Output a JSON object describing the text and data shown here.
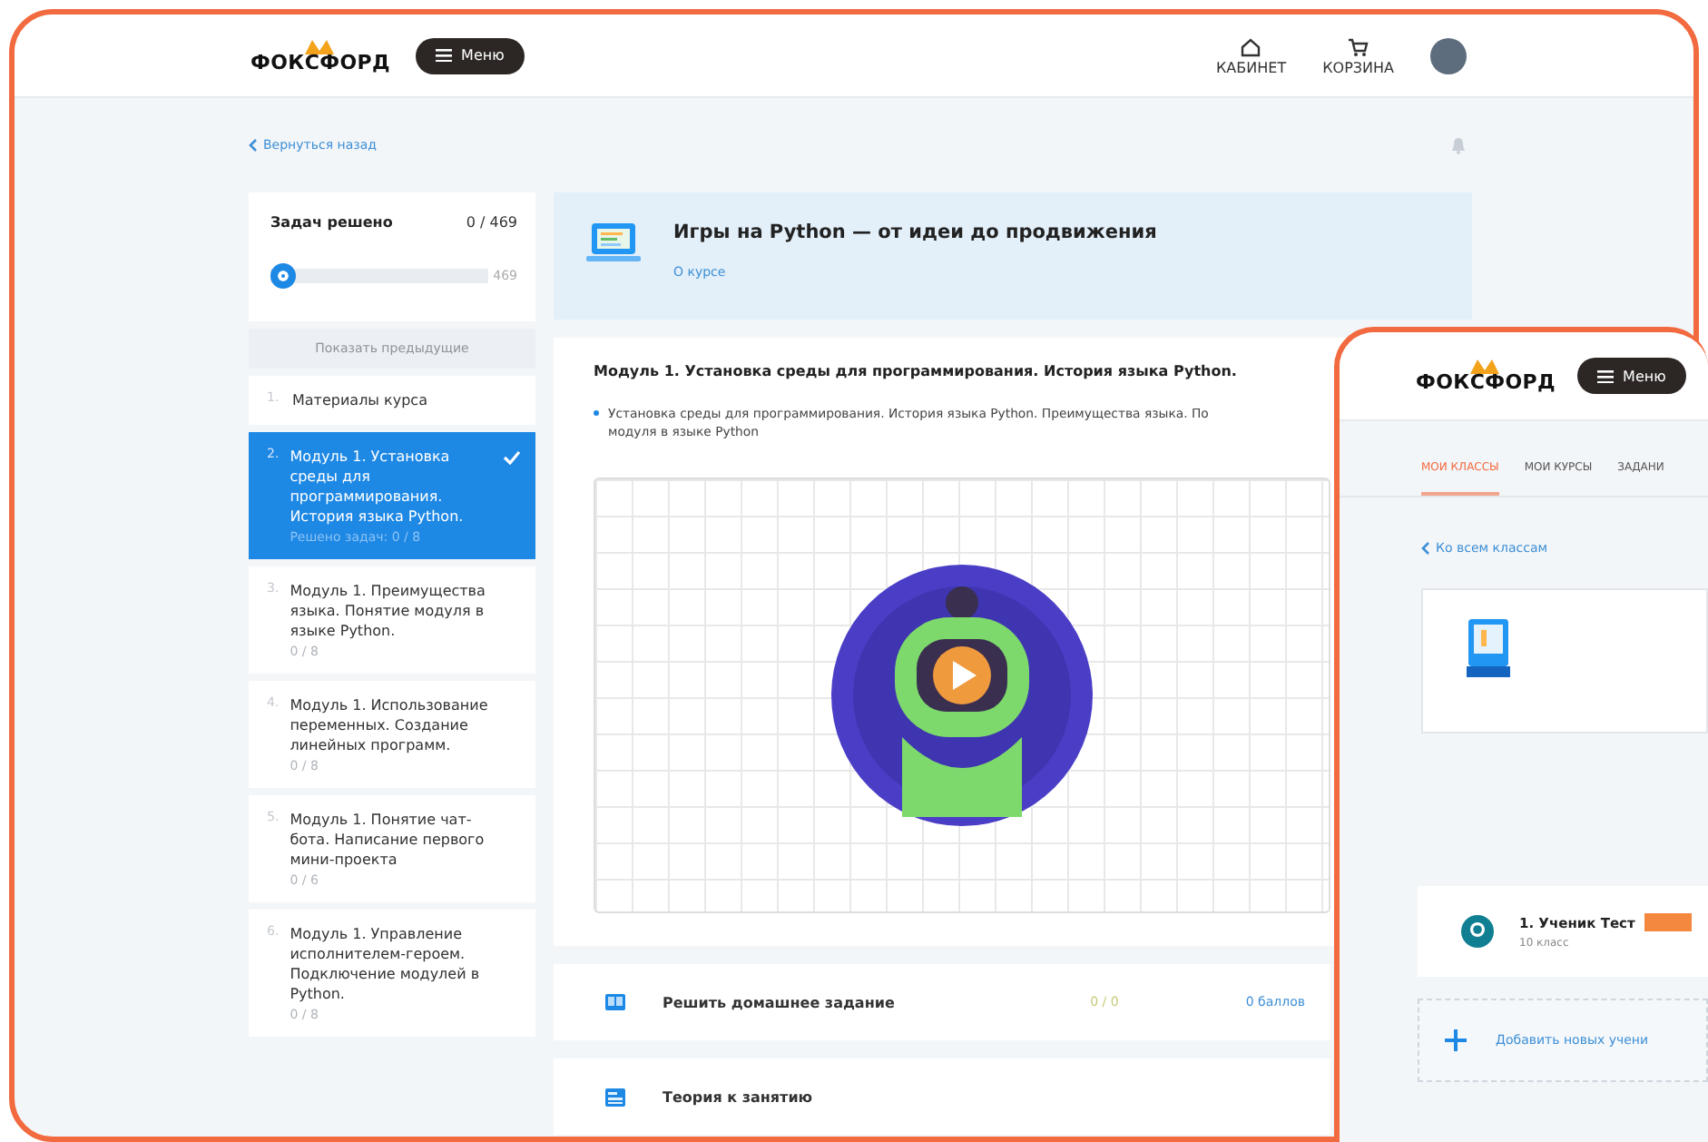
{
  "main": {
    "logo": "ФОКСФОРД",
    "menu_button": "Меню",
    "nav": [
      {
        "kind": "home",
        "label": "КАБИНЕТ"
      },
      {
        "kind": "cart",
        "label": "КОРЗИНА"
      }
    ],
    "back_link": "Вернуться назад",
    "progress": {
      "title": "Задач решено",
      "count": "0 / 469",
      "level": 0,
      "max_label": "469"
    },
    "show_previous": "Показать предыдущие",
    "lessons": [
      {
        "number": "1.",
        "title": "Материалы курса",
        "selected": false,
        "completed": false
      },
      {
        "number": "2.",
        "title": "Модуль 1. Установка среды для программирования. История языка Python.",
        "status": "Решено задач: 0 / 8",
        "selected": true,
        "completed": true
      },
      {
        "number": "3.",
        "title": "Модуль 1. Преимущества языка. Понятие модуля в языке Python.",
        "status": "0 / 8",
        "selected": false,
        "completed": false
      },
      {
        "number": "4.",
        "title": "Модуль 1. Использование переменных. Создание линейных программ.",
        "status": "0 / 8",
        "selected": false,
        "completed": false
      },
      {
        "number": "5.",
        "title": "Модуль 1. Понятие чат-бота. Написание первого мини-проекта",
        "status": "0 / 6",
        "selected": false,
        "completed": false
      },
      {
        "number": "6.",
        "title": "Модуль 1. Управление исполнителем-героем. Подключение модулей в Python.",
        "status": "0 / 8",
        "selected": false,
        "completed": false
      }
    ],
    "course": {
      "title": "Игры на Python — от идеи до продвижения",
      "link": "О курсе"
    },
    "module": {
      "title": "Модуль 1. Установка среды для программирования. История языка Python.",
      "description_lines": [
        "Установка среды для программирования. История языка Python. Преимущества языка. По",
        "модуля в языке Python"
      ]
    },
    "tasks": [
      {
        "kind": "homework",
        "title": "Решить домашнее задание",
        "score": "0 / 0",
        "points": "0 баллов"
      },
      {
        "kind": "theory",
        "title": "Теория к занятию"
      }
    ]
  },
  "overlay": {
    "logo": "ФОКСФОРД",
    "menu_button": "Меню",
    "tabs": [
      {
        "label": "МОИ КЛАССЫ",
        "selected": true
      },
      {
        "label": "МОИ КУРСЫ",
        "selected": false
      },
      {
        "label": "ЗАДАНИ",
        "selected": false
      }
    ],
    "back_link": "Ко всем классам",
    "student": {
      "name": "1. Ученик Тест",
      "grade": "10 класс"
    },
    "add_button": "Добавить новых учени"
  }
}
